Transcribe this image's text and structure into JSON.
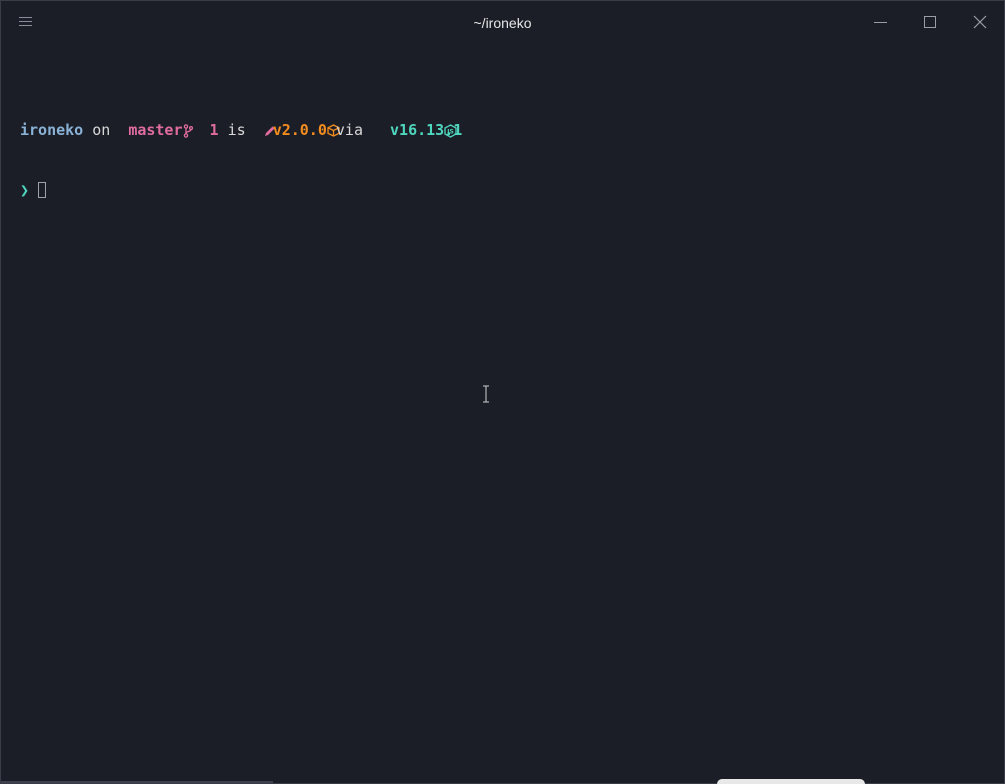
{
  "window": {
    "title": "~/ironeko",
    "menu_icon": "hamburger-menu-icon",
    "controls": {
      "minimize_icon": "minimize-icon",
      "maximize_icon": "maximize-icon",
      "close_icon": "close-icon"
    }
  },
  "prompt": {
    "user": "ironeko",
    "on": "on",
    "branch_icon": "git-branch-icon",
    "branch": "master",
    "modified_icon": "pencil-icon",
    "modified_count": "1",
    "is": "is",
    "package_icon": "package-icon",
    "package_version": "v2.0.0",
    "via": "via",
    "node_icon": "nodejs-icon",
    "node_version": "v16.13.1",
    "arrow": "❯"
  },
  "colors": {
    "background": "#1c1e27",
    "user": "#89b2d6",
    "branch": "#e06c9f",
    "package": "#f28c1e",
    "node": "#4fd6be",
    "arrow": "#4fd6be"
  }
}
